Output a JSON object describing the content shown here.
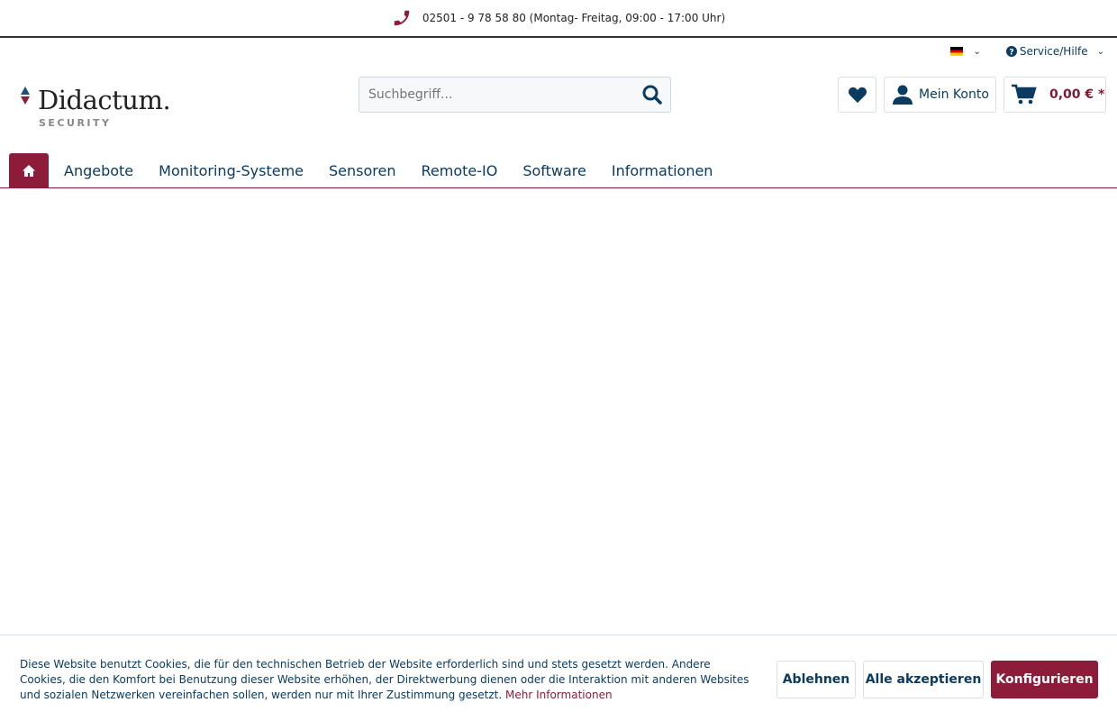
{
  "topbar": {
    "phone": "02501 - 9 78 58 80 (Montag- Freitag, 09:00 - 17:00 Uhr)",
    "icon": "phone-icon"
  },
  "meta": {
    "language": "de",
    "service": "Service/Hilfe"
  },
  "logo": {
    "name": "Didactum.",
    "sub": "SECURITY"
  },
  "search": {
    "placeholder": "Suchbegriff..."
  },
  "header": {
    "account": "Mein Konto",
    "cart": "0,00 € *"
  },
  "nav": {
    "items": [
      "Angebote",
      "Monitoring-Systeme",
      "Sensoren",
      "Remote-IO",
      "Software",
      "Informationen"
    ]
  },
  "cookie": {
    "text": "Diese Website benutzt Cookies, die für den technischen Betrieb der Website erforderlich sind und stets gesetzt werden. Andere Cookies, die den Komfort bei Benutzung dieser Website erhöhen, der Direktwerbung dienen oder die Interaktion mit anderen Websites und sozialen Netzwerken vereinfachen sollen, werden nur mit Ihrer Zustimmung gesetzt. ",
    "more": "Mehr Informationen",
    "decline": "Ablehnen",
    "accept": "Alle akzeptieren",
    "configure": "Konfigurieren"
  },
  "colors": {
    "brand": "#8c1c3a",
    "primary": "#0a3b60"
  }
}
